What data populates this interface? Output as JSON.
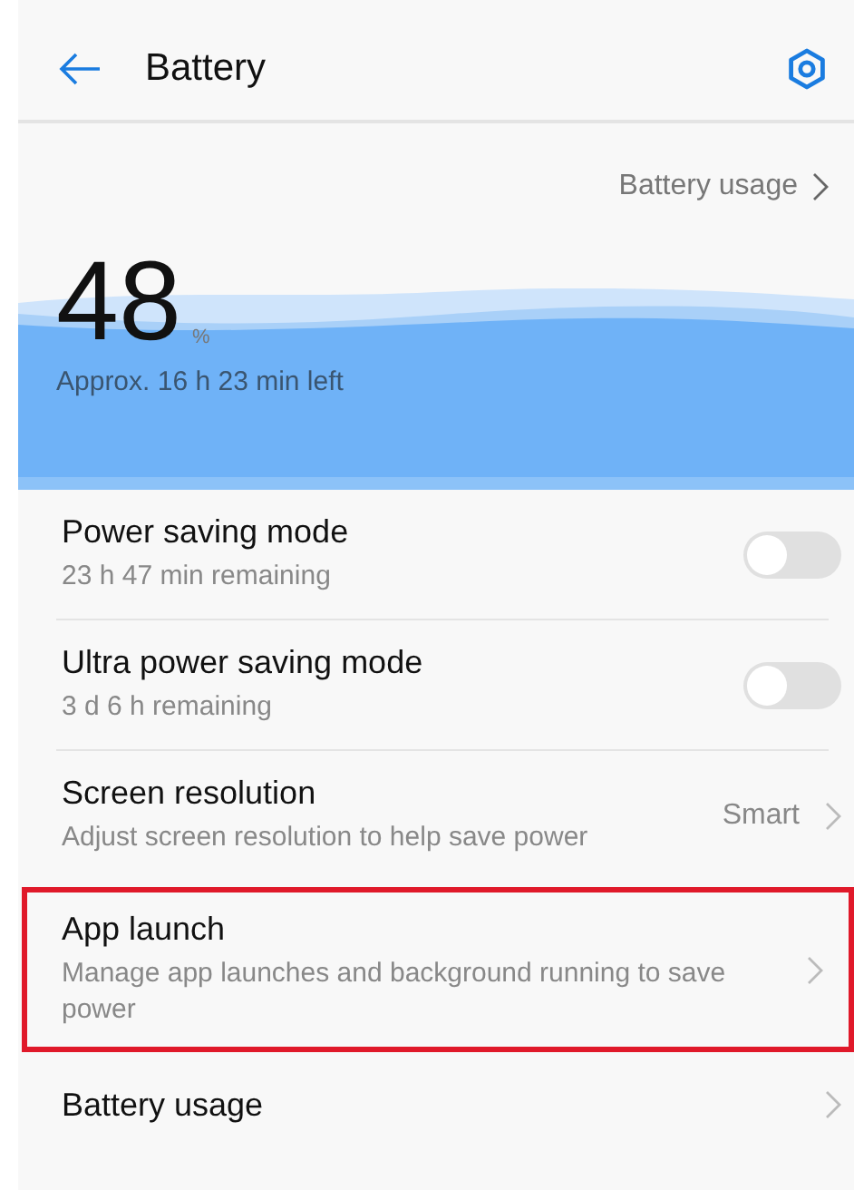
{
  "header": {
    "title": "Battery"
  },
  "battery_usage_link": "Battery usage",
  "level_display": {
    "percent": "48",
    "unit": "%",
    "estimate": "Approx. 16 h 23 min left"
  },
  "settings": [
    {
      "kind": "toggle",
      "title": "Power saving mode",
      "subtitle": "23 h 47 min remaining",
      "on": false,
      "highlighted": false
    },
    {
      "kind": "toggle",
      "title": "Ultra power saving mode",
      "subtitle": "3 d 6 h remaining",
      "on": false,
      "highlighted": false
    },
    {
      "kind": "value",
      "title": "Screen resolution",
      "subtitle": "Adjust screen resolution to help save power",
      "value": "Smart",
      "highlighted": false
    },
    {
      "kind": "link",
      "title": "App launch",
      "subtitle": "Manage app launches and background running to save power",
      "highlighted": true
    },
    {
      "kind": "link",
      "title": "Battery usage",
      "highlighted": false
    }
  ]
}
